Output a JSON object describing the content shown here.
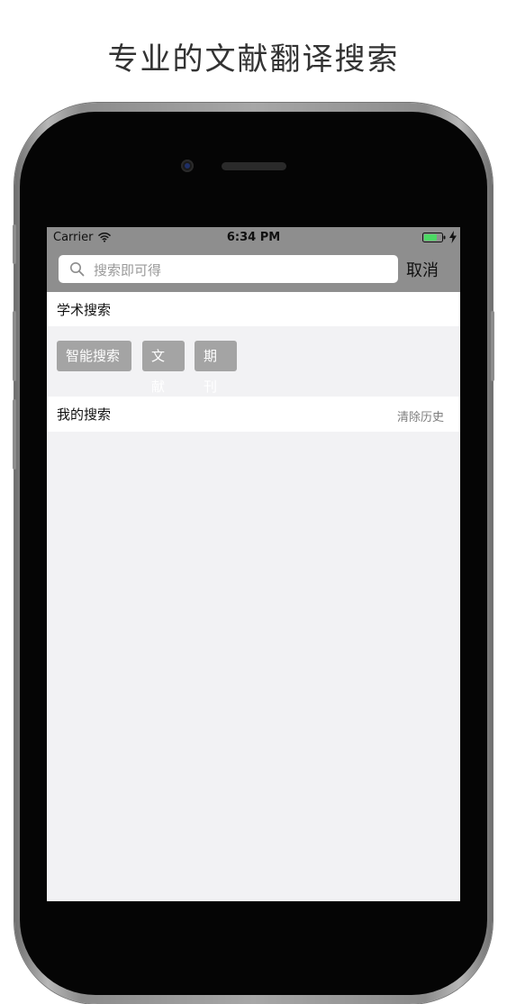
{
  "headline": "专业的文献翻译搜索",
  "status_bar": {
    "carrier": "Carrier",
    "time": "6:34 PM",
    "wifi_icon": "wifi-icon",
    "battery_icon": "battery-icon",
    "charging_icon": "bolt-icon"
  },
  "search": {
    "placeholder": "搜索即可得",
    "value": "",
    "search_icon": "search-icon",
    "cancel_label": "取消"
  },
  "academic_search": {
    "title": "学术搜索",
    "tags": [
      {
        "label": "智能搜索"
      },
      {
        "label": "文献"
      },
      {
        "label": "期刊"
      }
    ]
  },
  "history": {
    "title": "我的搜索",
    "clear_label": "清除历史"
  },
  "colors": {
    "status_bar": "#8e8e8e",
    "tag_background": "#a4a4a4",
    "screen_background": "#f2f2f4",
    "battery_fill": "#4cd964"
  }
}
